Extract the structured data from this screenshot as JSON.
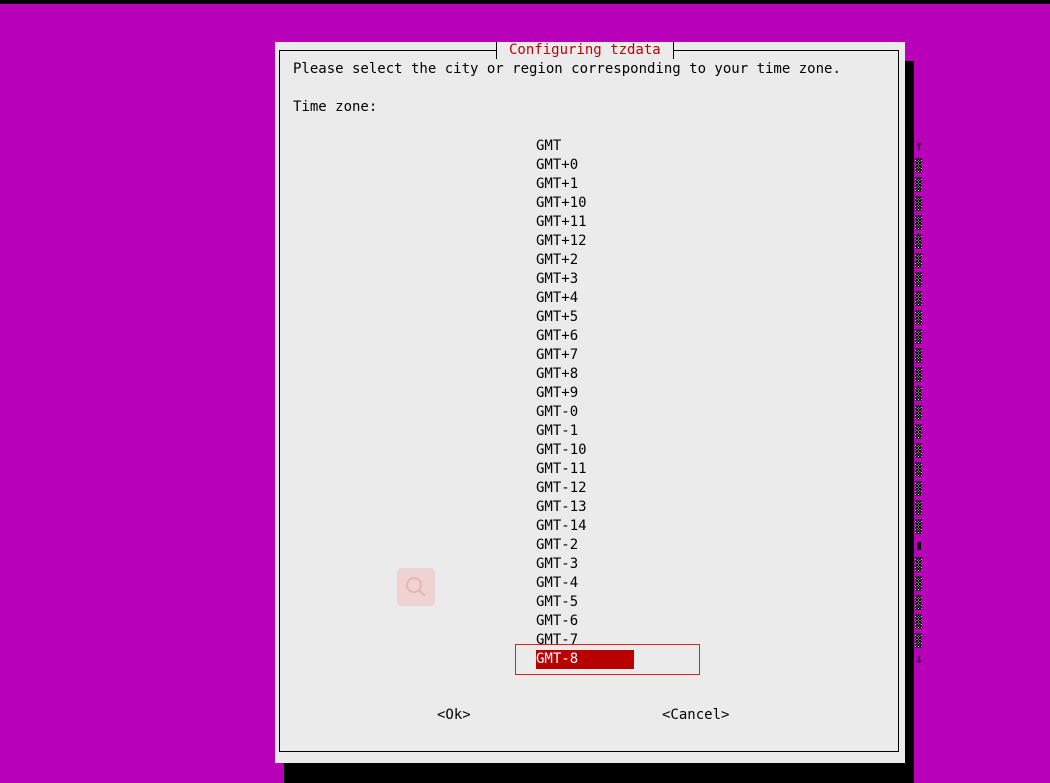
{
  "dialog": {
    "title": "Configuring tzdata",
    "prompt": "Please select the city or region corresponding to your time zone.",
    "field_label": "Time zone:",
    "options": [
      "GMT",
      "GMT+0",
      "GMT+1",
      "GMT+10",
      "GMT+11",
      "GMT+12",
      "GMT+2",
      "GMT+3",
      "GMT+4",
      "GMT+5",
      "GMT+6",
      "GMT+7",
      "GMT+8",
      "GMT+9",
      "GMT-0",
      "GMT-1",
      "GMT-10",
      "GMT-11",
      "GMT-12",
      "GMT-13",
      "GMT-14",
      "GMT-2",
      "GMT-3",
      "GMT-4",
      "GMT-5",
      "GMT-6",
      "GMT-7",
      "GMT-8"
    ],
    "selected": "GMT-8",
    "scroll_up": "↑",
    "scroll_down": "↓",
    "ok_label": "<Ok>",
    "cancel_label": "<Cancel>"
  },
  "colors": {
    "background": "#b800b8",
    "dialog": "#ebebeb",
    "title": "#c00000",
    "selection": "#b80000"
  }
}
